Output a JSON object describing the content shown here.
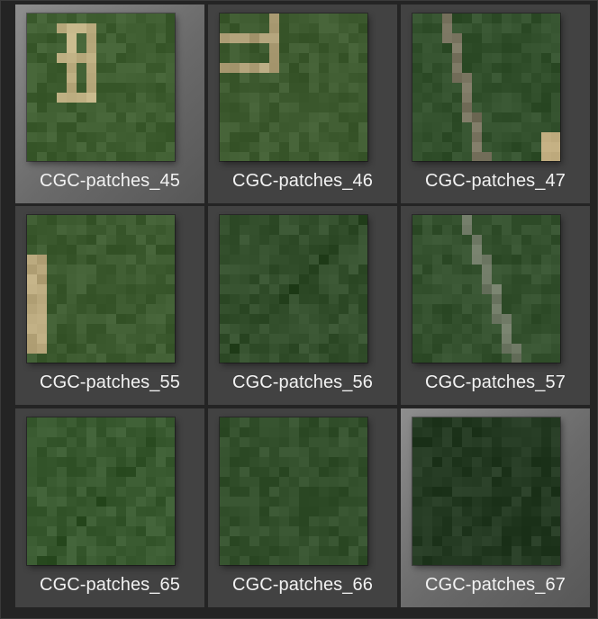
{
  "gallery": {
    "tiles": [
      {
        "label": "CGC-patches_45",
        "selected": true,
        "bg": "#3f5e31",
        "feature": "field"
      },
      {
        "label": "CGC-patches_46",
        "selected": false,
        "bg": "#3e5b30",
        "feature": "field2"
      },
      {
        "label": "CGC-patches_47",
        "selected": false,
        "bg": "#32502c",
        "feature": "road"
      },
      {
        "label": "CGC-patches_55",
        "selected": false,
        "bg": "#3d5b30",
        "feature": "edge-left"
      },
      {
        "label": "CGC-patches_56",
        "selected": false,
        "bg": "#34502d",
        "feature": "diag"
      },
      {
        "label": "CGC-patches_57",
        "selected": false,
        "bg": "#34512e",
        "feature": "road2"
      },
      {
        "label": "CGC-patches_65",
        "selected": false,
        "bg": "#395a30",
        "feature": "diag2"
      },
      {
        "label": "CGC-patches_66",
        "selected": false,
        "bg": "#33502c",
        "feature": "plain"
      },
      {
        "label": "CGC-patches_67",
        "selected": true,
        "bg": "#293f27",
        "feature": "dark"
      }
    ]
  }
}
